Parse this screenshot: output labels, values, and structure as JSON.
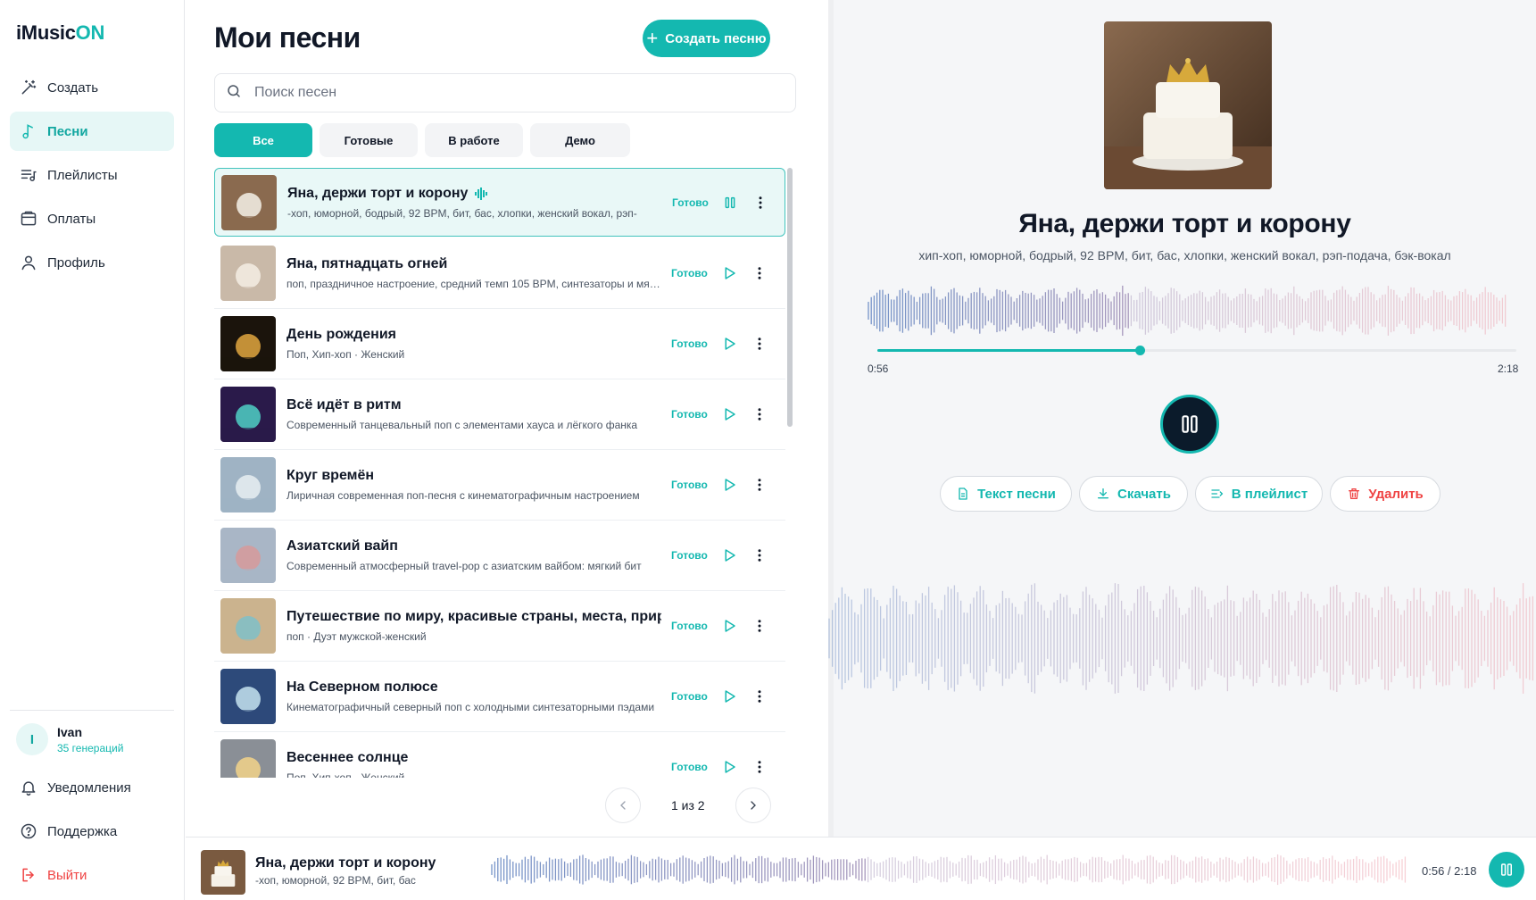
{
  "app": {
    "logo_main": "iMusic",
    "logo_accent": "ON"
  },
  "sidebar": {
    "items": [
      {
        "label": "Создать",
        "icon": "magic-wand-icon"
      },
      {
        "label": "Песни",
        "icon": "music-note-icon",
        "active": true
      },
      {
        "label": "Плейлисты",
        "icon": "playlist-icon"
      },
      {
        "label": "Оплаты",
        "icon": "wallet-icon"
      },
      {
        "label": "Профиль",
        "icon": "user-icon"
      }
    ],
    "user": {
      "initial": "I",
      "name": "Ivan",
      "generations": "35 генераций"
    },
    "bottom": [
      {
        "label": "Уведомления",
        "icon": "bell-icon"
      },
      {
        "label": "Поддержка",
        "icon": "help-icon"
      },
      {
        "label": "Выйти",
        "icon": "logout-icon"
      }
    ]
  },
  "songs_page": {
    "title": "Мои песни",
    "create_label": "Создать песню",
    "search_placeholder": "Поиск песен",
    "filters": [
      "Все",
      "Готовые",
      "В работе",
      "Демо"
    ],
    "pagination": "1 из 2",
    "songs": [
      {
        "title": "Яна, держи торт и корону",
        "subtitle": "-хоп, юморной, бодрый, 92 BPM, бит, бас, хлопки, женский вокал, рэп-",
        "status": "Готово",
        "playing": true
      },
      {
        "title": "Яна, пятнадцать огней",
        "subtitle": "поп, праздничное настроение, средний темп 105 BPM, синтезаторы и мягкий бас",
        "status": "Готово"
      },
      {
        "title": "День рождения",
        "subtitle": "Поп, Хип-хоп · Женский",
        "status": "Готово"
      },
      {
        "title": "Всё идёт в ритм",
        "subtitle": "Современный танцевальный поп с элементами хауса и лёгкого фанка",
        "status": "Готово"
      },
      {
        "title": "Круг времён",
        "subtitle": "Лиричная современная поп-песня с кинематографичным настроением",
        "status": "Готово"
      },
      {
        "title": "Азиатский вайп",
        "subtitle": "Современный атмосферный travel-pop с азиатским вайбом: мягкий бит",
        "status": "Готово"
      },
      {
        "title": "Путешествие по миру, красивые страны, места, природа",
        "subtitle": "поп · Дуэт мужской-женский",
        "status": "Готово"
      },
      {
        "title": "На Северном полюсе",
        "subtitle": "Кинематографичный северный поп с холодными синтезаторными пэдами",
        "status": "Готово"
      },
      {
        "title": "Весеннее солнце",
        "subtitle": "Поп, Хип-хоп · Женский",
        "status": "Готово"
      }
    ]
  },
  "now_playing": {
    "title": "Яна, держи торт и корону",
    "tags": "хип-хоп, юморной, бодрый, 92 BPM, бит, бас, хлопки, женский вокал, рэп-подача, бэк-вокал",
    "current_time": "0:56",
    "total_time": "2:18",
    "progress": 0.41,
    "actions": [
      {
        "label": "Текст песни",
        "icon": "document-icon"
      },
      {
        "label": "Скачать",
        "icon": "download-icon"
      },
      {
        "label": "В плейлист",
        "icon": "add-to-playlist-icon"
      },
      {
        "label": "Удалить",
        "icon": "trash-icon"
      }
    ]
  },
  "player": {
    "title": "Яна, держи торт и корону",
    "subtitle": "-хоп, юморной, 92 BPM, бит, бас",
    "time": "0:56 / 2:18"
  },
  "colors": {
    "accent": "#14b8b0",
    "danger": "#ef4444",
    "dark": "#0b1b2b",
    "wave_blue": "#6f8fc6",
    "wave_pink": "#ef9aa6"
  }
}
